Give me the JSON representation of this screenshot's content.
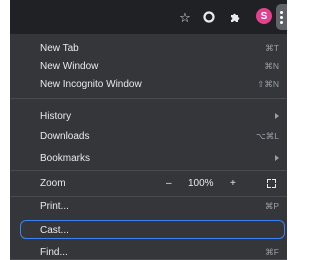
{
  "toolbar": {
    "icons": [
      "star-icon",
      "circle-extension-icon",
      "puzzle-icon",
      "profile-avatar",
      "kebab-menu-icon"
    ],
    "profile_initial": "S",
    "profile_color": "#e3418f"
  },
  "menu": {
    "new_tab": {
      "label": "New Tab",
      "shortcut": "⌘T"
    },
    "new_window": {
      "label": "New Window",
      "shortcut": "⌘N"
    },
    "new_incognito": {
      "label": "New Incognito Window",
      "shortcut": "⇧⌘N"
    },
    "history": {
      "label": "History"
    },
    "downloads": {
      "label": "Downloads",
      "shortcut": "⌥⌘L"
    },
    "bookmarks": {
      "label": "Bookmarks"
    },
    "zoom": {
      "label": "Zoom",
      "minus": "–",
      "level": "100%",
      "plus": "+"
    },
    "print": {
      "label": "Print...",
      "shortcut": "⌘P"
    },
    "cast": {
      "label": "Cast..."
    },
    "find": {
      "label": "Find...",
      "shortcut": "⌘F"
    }
  },
  "colors": {
    "menu_bg": "#35363a",
    "toolbar_bg": "#202124",
    "focus_ring": "#3b82f6"
  }
}
